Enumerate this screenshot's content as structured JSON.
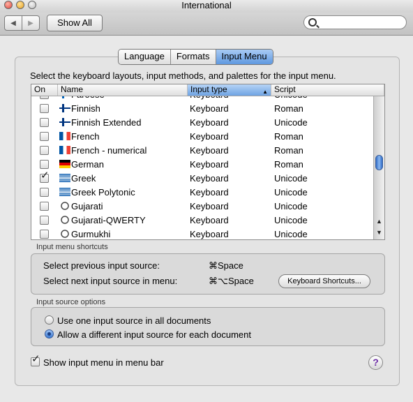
{
  "window": {
    "title": "International"
  },
  "toolbar": {
    "show_all": "Show All",
    "search_placeholder": ""
  },
  "tabs": [
    {
      "label": "Language",
      "selected": false
    },
    {
      "label": "Formats",
      "selected": false
    },
    {
      "label": "Input Menu",
      "selected": true
    }
  ],
  "instructions": "Select the keyboard layouts, input methods, and palettes for the input menu.",
  "table": {
    "headers": {
      "on": "On",
      "name": "Name",
      "type": "Input type",
      "script": "Script"
    },
    "rows": [
      {
        "name": "Faroese",
        "type": "Keyboard",
        "script": "Unicode",
        "checked": false,
        "flag": "faroe"
      },
      {
        "name": "Finnish",
        "type": "Keyboard",
        "script": "Roman",
        "checked": false,
        "flag": "finland"
      },
      {
        "name": "Finnish Extended",
        "type": "Keyboard",
        "script": "Unicode",
        "checked": false,
        "flag": "finland-ext"
      },
      {
        "name": "French",
        "type": "Keyboard",
        "script": "Roman",
        "checked": false,
        "flag": "france"
      },
      {
        "name": "French - numerical",
        "type": "Keyboard",
        "script": "Roman",
        "checked": false,
        "flag": "france-123"
      },
      {
        "name": "German",
        "type": "Keyboard",
        "script": "Roman",
        "checked": false,
        "flag": "germany"
      },
      {
        "name": "Greek",
        "type": "Keyboard",
        "script": "Unicode",
        "checked": true,
        "flag": "greece"
      },
      {
        "name": "Greek Polytonic",
        "type": "Keyboard",
        "script": "Unicode",
        "checked": false,
        "flag": "greece-poly"
      },
      {
        "name": "Gujarati",
        "type": "Keyboard",
        "script": "Unicode",
        "checked": false,
        "flag": "gujarati"
      },
      {
        "name": "Gujarati-QWERTY",
        "type": "Keyboard",
        "script": "Unicode",
        "checked": false,
        "flag": "gujarati-q"
      },
      {
        "name": "Gurmukhi",
        "type": "Keyboard",
        "script": "Unicode",
        "checked": false,
        "flag": "gurmukhi"
      }
    ],
    "flag_badges": {
      "finland-ext": "§",
      "france-123": "123"
    }
  },
  "shortcuts": {
    "group_label": "Input menu shortcuts",
    "previous_label": "Select previous input source:",
    "previous_key": "⌘Space",
    "next_label": "Select next input source in menu:",
    "next_key": "⌘⌥Space",
    "button": "Keyboard Shortcuts..."
  },
  "options": {
    "group_label": "Input source options",
    "one_source": "Use one input source in all documents",
    "per_document": "Allow a different input source for each document",
    "selected": "per_document"
  },
  "show_menu": {
    "label": "Show input menu in menu bar",
    "checked": true
  },
  "help": "?"
}
